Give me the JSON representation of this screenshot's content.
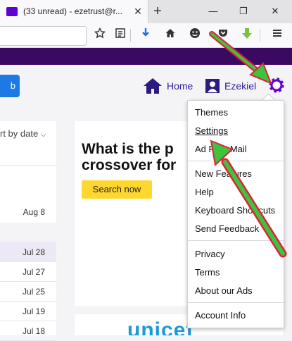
{
  "browser": {
    "tab_title": "(33 unread) - ezetrust@r...",
    "tab_close": "✕",
    "new_tab": "+",
    "minimize": "—",
    "restore": "❐",
    "close": "✕"
  },
  "toolbar_icons": [
    "star-icon",
    "reader-icon",
    "download-icon",
    "home-icon",
    "emoji-icon",
    "pocket-icon",
    "extension-icon",
    "menu-icon"
  ],
  "header": {
    "compose_label": "b",
    "home_label": "Home",
    "user_label": "Ezekiel"
  },
  "mail_list": {
    "sort_label": "rt by date",
    "rows": [
      {
        "date": "Aug 8"
      },
      {
        "date": "Jul 28"
      },
      {
        "date": "Jul 27"
      },
      {
        "date": "Jul 25"
      },
      {
        "date": "Jul 19"
      },
      {
        "date": "Jul 18"
      }
    ]
  },
  "content": {
    "headline_line1": "What is the p",
    "headline_line2": "crossover for",
    "search_button": "Search now",
    "ad_brand": "unicef"
  },
  "menu": {
    "items": [
      "Themes",
      "Settings",
      "Ad Free Mail",
      "New Features",
      "Help",
      "Keyboard Shortcuts",
      "Send Feedback",
      "Privacy",
      "Terms",
      "About our Ads",
      "Account Info"
    ]
  },
  "colors": {
    "brand_purple": "#3a0a63",
    "link_blue": "#2d1b9e",
    "annotation_green": "#3cc43c",
    "annotation_red": "#e0203a",
    "search_yellow": "#ffd72e"
  }
}
